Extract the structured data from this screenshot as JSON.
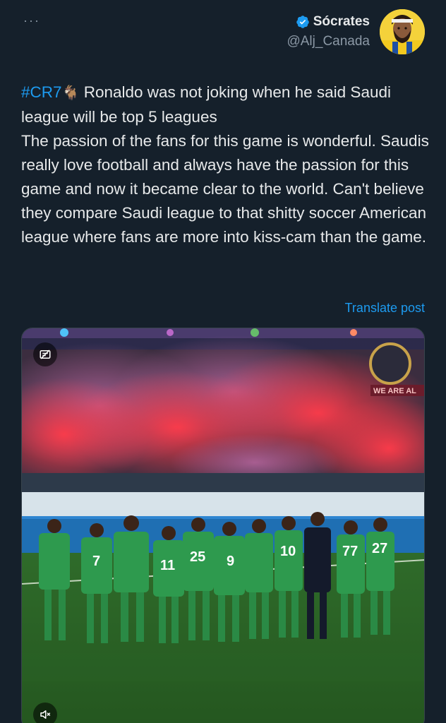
{
  "header": {
    "more_label": "···",
    "author_name": "Sócrates",
    "author_handle": "@Alj_Canada",
    "verified_icon": "verified-badge-icon",
    "accent": "#1d9bf0"
  },
  "post": {
    "hashtag": "#CR7",
    "goat_emoji": "🐐",
    "text_first": " Ronaldo was not joking when he said Saudi league will be top 5 leagues",
    "text_rest": "The passion of the fans for this game is wonderful. Saudis really love football and always have the passion for this game and now it became clear to the world. Can't believe they compare Saudi league to that shitty soccer American league where fans are more into kiss-cam than the game.",
    "translate_label": "Translate post"
  },
  "media": {
    "banner_text": "WE ARE AL",
    "shirt_numbers": [
      "7",
      "11",
      "25",
      "9",
      "10",
      "77",
      "27"
    ],
    "alt_icon": "gif-alt-icon",
    "mute_icon": "speaker-muted-icon"
  }
}
